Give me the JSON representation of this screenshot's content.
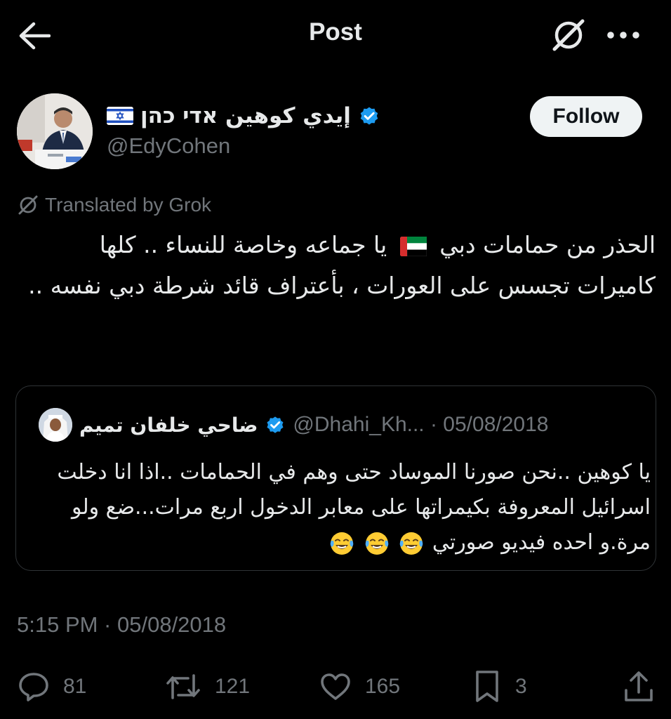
{
  "header": {
    "title": "Post",
    "back_icon": "arrow-left-icon",
    "grok_icon": "grok-icon",
    "more_icon": "more-horizontal-icon"
  },
  "author": {
    "display_name": "إيدي كوهين אדי כהן",
    "handle": "@EdyCohen",
    "flag": "israel-flag-icon",
    "verified": true
  },
  "follow_label": "Follow",
  "translated_label": "Translated by Grok",
  "tweet": {
    "text_part1": "الحذر من حمامات دبي",
    "text_part2": "يا جماعه وخاصة للنساء .. كلها كاميرات تجسس على العورات ، بأعتراف قائد شرطة دبي نفسه ..",
    "flag": "uae-flag-icon"
  },
  "quote": {
    "display_name": "ضاحي خلفان تميم",
    "verified": true,
    "meta": "@Dhahi_Kh... · 05/08/2018",
    "text": "يا كوهين ..نحن صورنا الموساد حتى وهم في الحمامات ..اذا انا دخلت اسرائيل المعروفة بكيمراتها على معابر الدخول اربع مرات...ضع ولو مرة.و احده فيديو صورتي",
    "emoji": "face-with-tears-of-joy-emoji"
  },
  "timestamp": "5:15 PM · 05/08/2018",
  "actions": {
    "replies": "81",
    "reposts": "121",
    "likes": "165",
    "bookmarks": "3"
  },
  "colors": {
    "background": "#000000",
    "text": "#e7e9ea",
    "muted": "#71767b",
    "verified_blue": "#1d9bf0",
    "border": "#2f3336"
  }
}
